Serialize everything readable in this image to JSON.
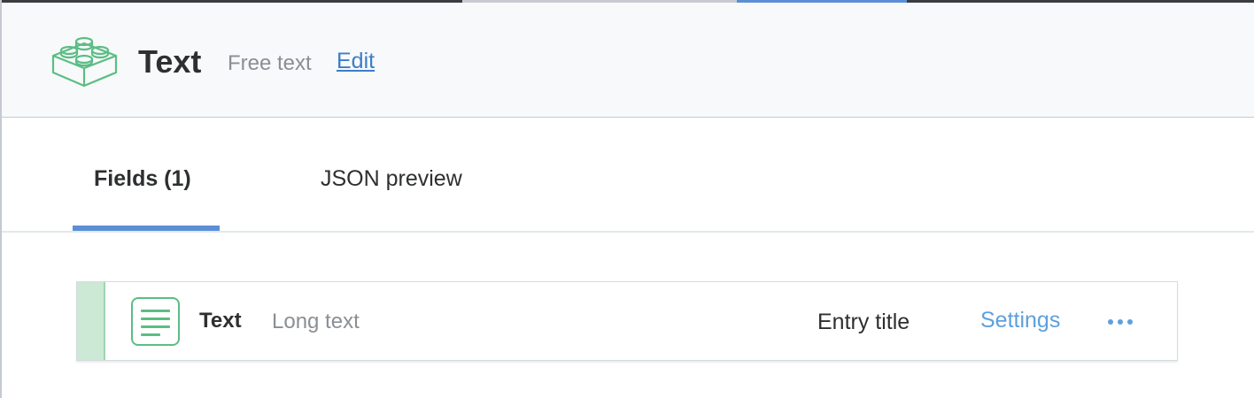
{
  "header": {
    "icon": "content-type-block-icon",
    "title": "Text",
    "description": "Free text",
    "edit_label": "Edit"
  },
  "tabs": [
    {
      "label": "Fields (1)",
      "active": true
    },
    {
      "label": "JSON preview",
      "active": false
    }
  ],
  "fields": [
    {
      "icon": "long-text-icon",
      "name": "Text",
      "type": "Long text",
      "status": "Entry title",
      "settings_label": "Settings",
      "more_icon": "more-horizontal-icon"
    }
  ],
  "colors": {
    "accent_blue": "#5b8fd6",
    "link_blue": "#3d7dc8",
    "settings_blue": "#5ea0dc",
    "icon_green": "#5cbd85",
    "handle_green": "#cbe9d5",
    "header_bg": "#f7f9fa"
  }
}
